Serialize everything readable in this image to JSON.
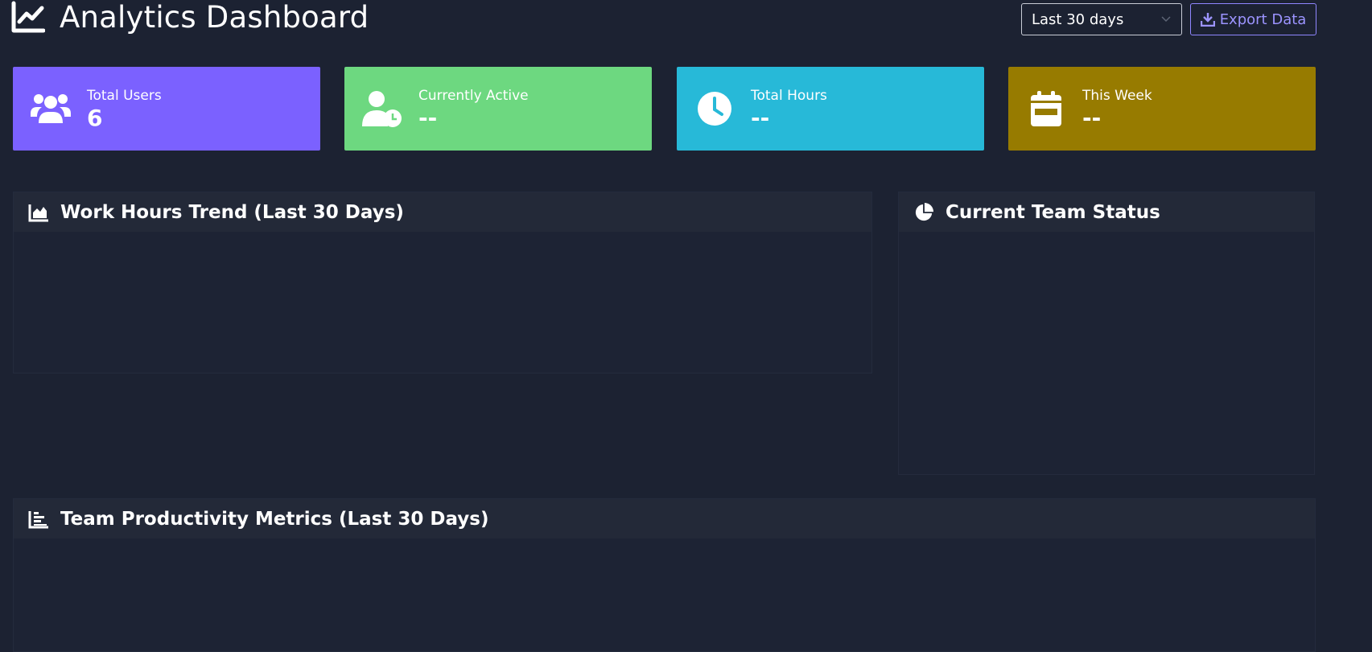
{
  "header": {
    "title": "Analytics Dashboard",
    "title_icon": "chart-line-icon",
    "date_range": {
      "selected": "Last 30 days"
    },
    "export_label": "Export Data"
  },
  "stats": [
    {
      "label": "Total Users",
      "value": "6",
      "icon": "users-icon",
      "color": "#7b61ff"
    },
    {
      "label": "Currently Active",
      "value": "--",
      "icon": "user-clock-icon",
      "color": "#6dd880"
    },
    {
      "label": "Total Hours",
      "value": "--",
      "icon": "clock-icon",
      "color": "#27b9d8"
    },
    {
      "label": "This Week",
      "value": "--",
      "icon": "calendar-week-icon",
      "color": "#977b00"
    }
  ],
  "panels": {
    "trend": {
      "title": "Work Hours Trend (Last 30 Days)",
      "icon": "area-chart-icon"
    },
    "status": {
      "title": "Current Team Status",
      "icon": "pie-chart-icon"
    },
    "metrics": {
      "title": "Team Productivity Metrics (Last 30 Days)",
      "icon": "bar-chart-icon"
    }
  },
  "colors": {
    "background": "#1c2232",
    "panel_header": "#232938",
    "accent": "#9c94ff"
  }
}
